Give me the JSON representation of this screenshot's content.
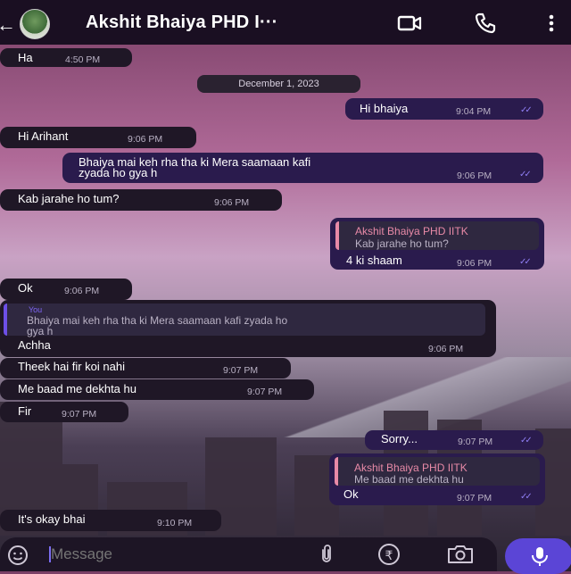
{
  "header": {
    "back_icon": "arrow-left-icon",
    "contact_name": "Akshit Bhaiya PHD I···",
    "icons": [
      "video-call-icon",
      "phone-icon",
      "more-vert-icon"
    ]
  },
  "date_chip": "December 1, 2023",
  "messages": [
    {
      "text": "Ha",
      "time": "4:50 PM"
    },
    {
      "text": "Hi bhaiya",
      "time": "9:04 PM"
    },
    {
      "text": "Hi Arihant",
      "time": "9:06 PM"
    },
    {
      "text": "Bhaiya mai keh rha tha ki Mera saamaan kafi zyada ho gya h",
      "line1": "Bhaiya mai keh rha tha ki Mera saamaan kafi",
      "line2": "zyada ho gya h",
      "time": "9:06 PM"
    },
    {
      "text": "Kab jarahe ho tum?",
      "time": "9:06 PM"
    },
    {
      "quote_name": "Akshit Bhaiya PHD IITK",
      "quote_text": "Kab jarahe ho tum?",
      "text": "4 ki shaam",
      "time": "9:06 PM"
    },
    {
      "text": "Ok",
      "time": "9:06 PM"
    },
    {
      "quote_name": "You",
      "quote_line1": "Bhaiya mai keh rha tha ki Mera saamaan kafi zyada ho",
      "quote_line2": "gya h",
      "text": "Achha",
      "time": "9:06 PM"
    },
    {
      "text": "Theek hai fir koi nahi",
      "time": "9:07 PM"
    },
    {
      "text": "Me baad me dekhta hu",
      "time": "9:07 PM"
    },
    {
      "text": "Fir",
      "time": "9:07 PM"
    },
    {
      "text": "Sorry...",
      "time": "9:07 PM"
    },
    {
      "quote_name": "Akshit Bhaiya PHD IITK",
      "quote_text": "Me baad me dekhta hu",
      "text": "Ok",
      "time": "9:07 PM"
    },
    {
      "text": "It's okay bhai",
      "time": "9:10 PM"
    }
  ],
  "read_ticks": "✓✓",
  "input": {
    "placeholder": "Message",
    "emoji_icon": "emoji-icon",
    "attach_icon": "paperclip-icon",
    "rupee_symbol": "₹",
    "camera_icon": "camera-icon",
    "mic_icon": "mic-icon"
  },
  "colors": {
    "header_bg": "#1a0f22",
    "incoming_bubble": "#1f1726",
    "outgoing_bubble": "#2a1b4d",
    "accent": "#5b45d6",
    "read_tick": "#8e7df2",
    "quote_bar_contact": "#e88aa7",
    "quote_bar_you": "#6d4fe6"
  }
}
